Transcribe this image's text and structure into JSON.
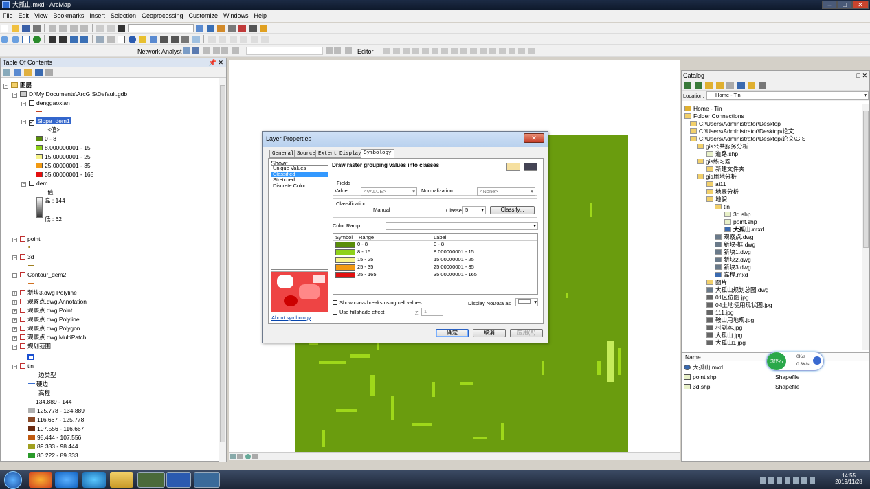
{
  "window": {
    "title": "大孤山.mxd - ArcMap"
  },
  "menu": [
    "File",
    "Edit",
    "View",
    "Bookmarks",
    "Insert",
    "Selection",
    "Geoprocessing",
    "Customize",
    "Windows",
    "Help"
  ],
  "toolbar": {
    "network_analyst": "Network Analyst",
    "editor": "Editor"
  },
  "toc": {
    "title": "Table Of Contents",
    "rows": [
      "图层",
      "D:\\My Documents\\ArcGIS\\Default.gdb",
      "denggaoxian",
      "Slope_dem1",
      "<值>",
      "0 - 8",
      "8.000000001 - 15",
      "15.00000001 - 25",
      "25.00000001 - 35",
      "35.00000001 - 165",
      "dem",
      "值",
      "高 : 144",
      "低 : 62",
      "point",
      "3d",
      "Contour_dem2",
      "新块3.dwg Polyline",
      "观察点.dwg Annotation",
      "观察点.dwg Point",
      "观察点.dwg Polyline",
      "观察点.dwg Polygon",
      "观察点.dwg MultiPatch",
      "规划范围",
      "tin",
      "边类型",
      "硬边",
      "高程",
      "134.889 - 144",
      "125.778 - 134.889",
      "116.667 - 125.778",
      "107.556 - 116.667",
      "98.444 - 107.556",
      "89.333 - 98.444",
      "80.222 - 89.333"
    ]
  },
  "colors": {
    "c1": "#5a8e0a",
    "c2": "#8fd11a",
    "c3": "#f7f48a",
    "c4": "#f29a12",
    "c5": "#e31010"
  },
  "dialog": {
    "title": "Layer Properties",
    "tabs": [
      "General",
      "Source",
      "Extent",
      "Display",
      "Symbology"
    ],
    "show_label": "Show:",
    "show_items": [
      "Unique Values",
      "Classified",
      "Stretched",
      "Discrete Color"
    ],
    "heading": "Draw raster grouping values into classes",
    "fields_label": "Fields",
    "value_label": "Value",
    "value_sel": "<VALUE>",
    "normalization_label": "Normalization",
    "normalization_sel": "<None>",
    "classification_label": "Classification",
    "method": "Manual",
    "classes_label": "Classes",
    "classes_val": "5",
    "classify_btn": "Classify...",
    "color_ramp_label": "Color Ramp",
    "col_symbol": "Symbol",
    "col_range": "Range",
    "col_label": "Label",
    "ranges": [
      "0 - 8",
      "8 - 15",
      "15 - 25",
      "25 - 35",
      "35 - 165"
    ],
    "labels": [
      "0 - 8",
      "8.000000001 - 15",
      "15.00000001 - 25",
      "25.00000001 - 35",
      "35.00000001 - 165"
    ],
    "cb_breaks": "Show class breaks using cell values",
    "cb_hillshade": "Use hillshade effect",
    "z_label": "Z:",
    "z_val": "1",
    "nodata_label": "Display NoData as",
    "about": "About symbology",
    "ok": "确定",
    "cancel": "取消",
    "apply": "应用(A)"
  },
  "catalog": {
    "title": "Catalog",
    "location_label": "Location:",
    "location_val": "Home - Tin",
    "tree": [
      "Home - Tin",
      "Folder Connections",
      "C:\\Users\\Administrator\\Desktop",
      "C:\\Users\\Administrator\\Desktop\\论文",
      "C:\\Users\\Administrator\\Desktop\\论文\\GIS",
      "gis公共服务分析",
      "道路.shp",
      "gis练习题",
      "新建文件夹",
      "gis用地分析",
      "ai11",
      "地表分析",
      "地貌",
      "tin",
      "3d.shp",
      "point.shp",
      "大孤山.mxd",
      "观察点.dwg",
      "新块-框.dwg",
      "新块1.dwg",
      "新块2.dwg",
      "新块3.dwg",
      "高程.mxd",
      "图片",
      "大孤山规划总图.dwg",
      "01区位图.jpg",
      "04土地使用现状图.jpg",
      "111.jpg",
      "鞍山用地规.jpg",
      "村副本.jpg",
      "大孤山.jpg",
      "大孤山1.jpg"
    ],
    "list_header": "Name",
    "list": [
      {
        "name": "大孤山.mxd",
        "type": ""
      },
      {
        "name": "point.shp",
        "type": "Shapefile"
      },
      {
        "name": "3d.shp",
        "type": "Shapefile"
      }
    ]
  },
  "netwidget": {
    "pct": "38%",
    "up": "0K/s",
    "down": "0.3K/s"
  },
  "taskbar": {
    "time": "14:55",
    "date": "2019/11/28"
  }
}
